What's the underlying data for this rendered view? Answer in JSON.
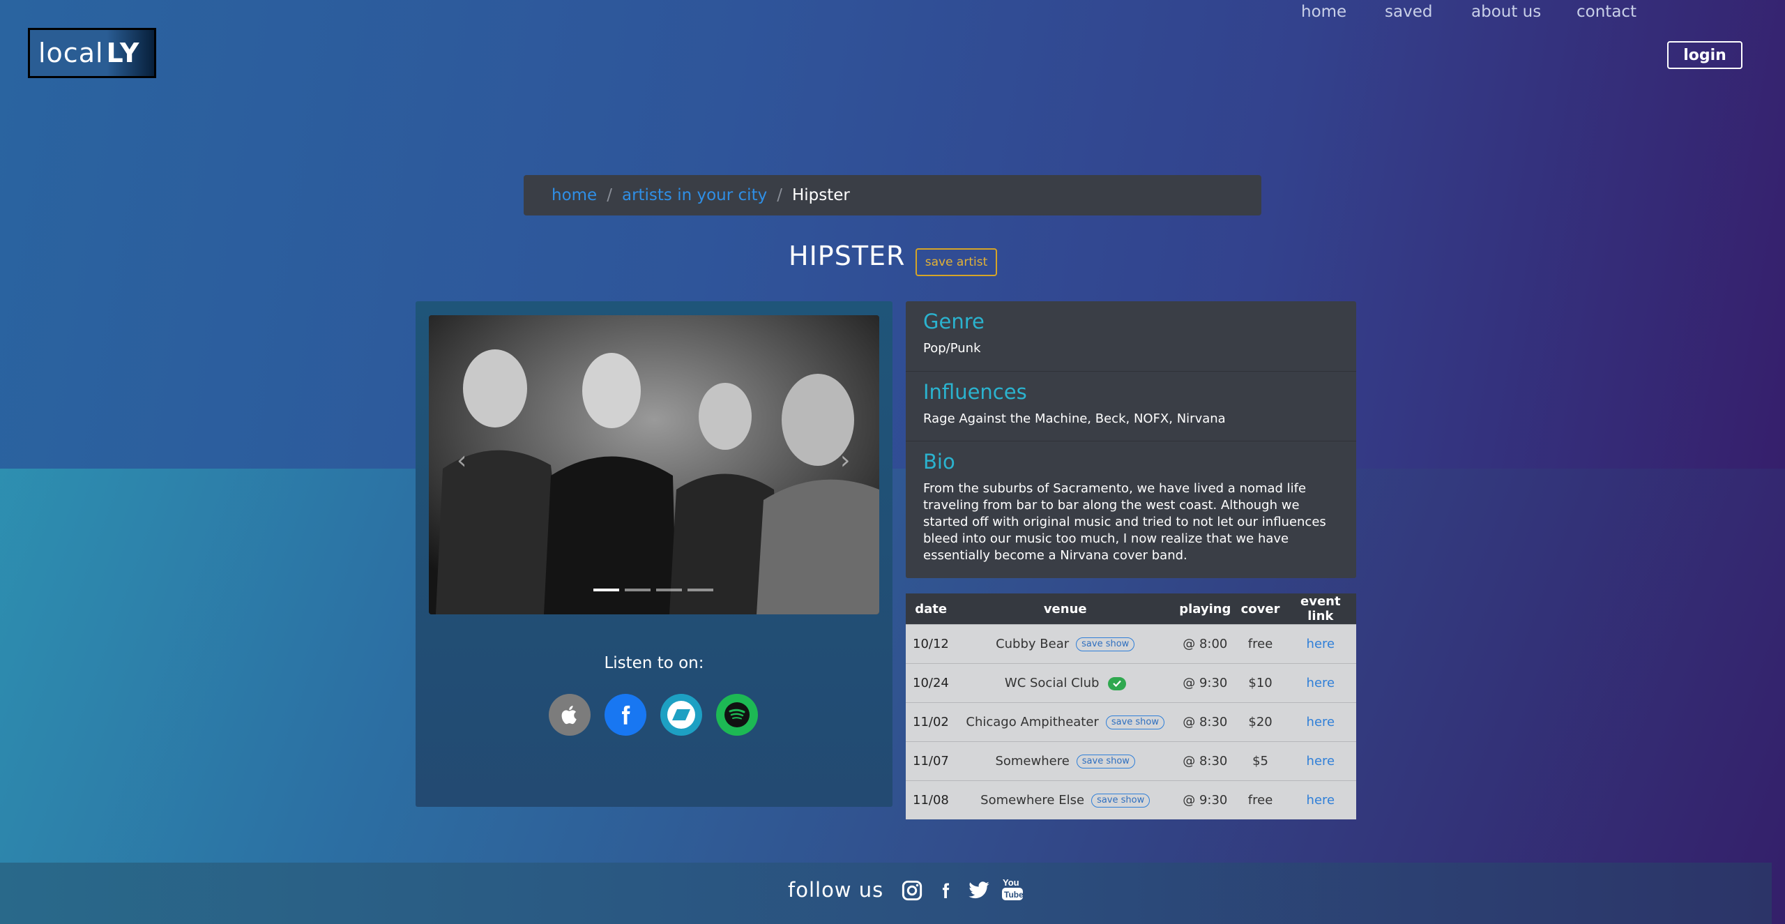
{
  "header": {
    "logo_plain": "local",
    "logo_bold": "LY",
    "nav": [
      "home",
      "saved",
      "about us",
      "contact"
    ],
    "login": "login"
  },
  "breadcrumb": {
    "items": [
      "home",
      "artists in your city"
    ],
    "current": "Hipster"
  },
  "artist": {
    "name": "HIPSTER",
    "save_label": "save artist"
  },
  "carousel": {
    "slide_count": 4,
    "active_index": 0
  },
  "listen": {
    "label": "Listen to on:",
    "services": [
      {
        "icon": "apple-music-icon",
        "color": "#7c7c7c"
      },
      {
        "icon": "facebook-icon",
        "color": "#1877f2"
      },
      {
        "icon": "bandcamp-icon",
        "color": "#1da0c3"
      },
      {
        "icon": "spotify-icon",
        "color": "#1db954"
      }
    ]
  },
  "info": {
    "genre_title": "Genre",
    "genre": "Pop/Punk",
    "influences_title": "Influences",
    "influences": "Rage Against the Machine, Beck, NOFX, Nirvana",
    "bio_title": "Bio",
    "bio": "From the suburbs of Sacramento, we have lived a nomad life traveling from bar to bar along the west coast. Although we started off with original music and tried to not let our influences bleed into our music too much, I now realize that we have essentially become a Nirvana cover band."
  },
  "shows": {
    "columns": [
      "date",
      "venue",
      "playing",
      "cover",
      "event link"
    ],
    "save_label": "save show",
    "rows": [
      {
        "date": "10/12",
        "venue": "Cubby Bear",
        "saved": false,
        "playing": "@ 8:00",
        "cover": "free",
        "link": "here"
      },
      {
        "date": "10/24",
        "venue": "WC Social Club",
        "saved": true,
        "playing": "@ 9:30",
        "cover": "$10",
        "link": "here"
      },
      {
        "date": "11/02",
        "venue": "Chicago Ampitheater",
        "saved": false,
        "playing": "@ 8:30",
        "cover": "$20",
        "link": "here"
      },
      {
        "date": "11/07",
        "venue": "Somewhere",
        "saved": false,
        "playing": "@ 8:30",
        "cover": "$5",
        "link": "here"
      },
      {
        "date": "11/08",
        "venue": "Somewhere Else",
        "saved": false,
        "playing": "@ 9:30",
        "cover": "free",
        "link": "here"
      }
    ]
  },
  "footer": {
    "label": "follow us",
    "icons": [
      "instagram-icon",
      "facebook-icon",
      "twitter-icon",
      "youtube-icon"
    ]
  },
  "colors": {
    "accent_teal": "#2bb3cf",
    "link_blue": "#2f8fe6",
    "save_gold": "#e3b236",
    "saved_green": "#2fa84f"
  }
}
